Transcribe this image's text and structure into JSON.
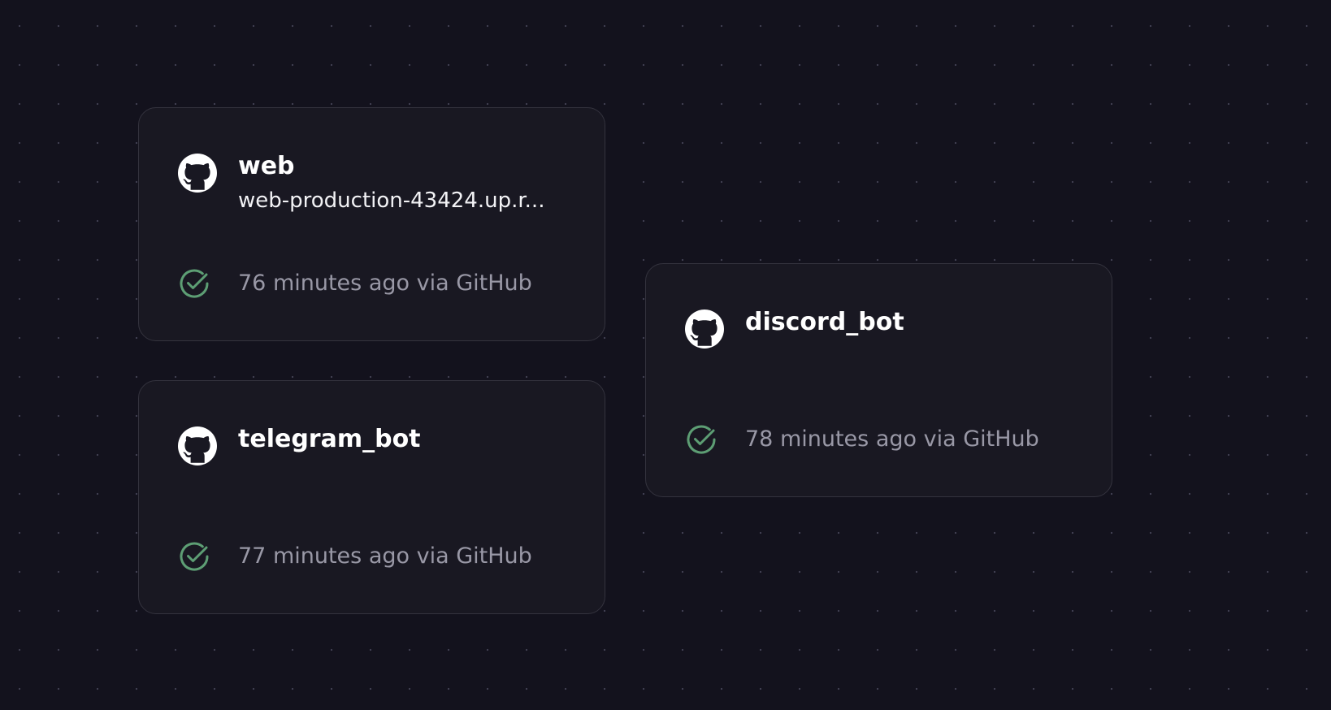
{
  "canvas": {
    "background_color": "#13121d",
    "grid": "dots"
  },
  "colors": {
    "card_background": "#191822",
    "card_border": "#34333e",
    "title_text": "#ffffff",
    "status_text": "#9998a6",
    "success_green": "#5d9e74"
  },
  "services": {
    "web": {
      "name": "web",
      "domain": "web-production-43424.up.r...",
      "source_icon": "github-icon",
      "status_icon": "check-circle-icon",
      "status": "76 minutes ago via GitHub"
    },
    "telegram": {
      "name": "telegram_bot",
      "source_icon": "github-icon",
      "status_icon": "check-circle-icon",
      "status": "77 minutes ago via GitHub"
    },
    "discord": {
      "name": "discord_bot",
      "source_icon": "github-icon",
      "status_icon": "check-circle-icon",
      "status": "78 minutes ago via GitHub"
    }
  }
}
